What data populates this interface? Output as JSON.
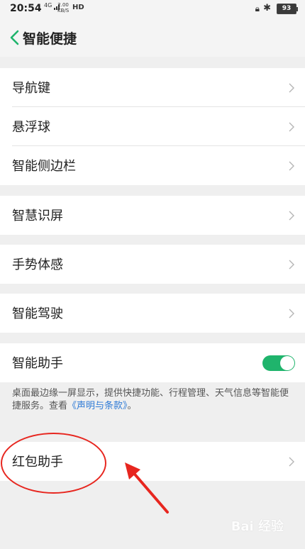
{
  "status_bar": {
    "time": "20:54",
    "network": "4G",
    "speed_value": "2.00",
    "speed_unit": "KB/S",
    "hd": "HD",
    "battery": "93",
    "icons": [
      "signal-icon",
      "hd-icon",
      "lock-rotation-icon",
      "bluetooth-icon",
      "battery-icon"
    ]
  },
  "header": {
    "title": "智能便捷"
  },
  "groups": {
    "g1": [
      "导航键",
      "悬浮球",
      "智能侧边栏"
    ],
    "g2": [
      "智慧识屏"
    ],
    "g3": [
      "手势体感"
    ],
    "g4": [
      "智能驾驶"
    ],
    "g5": [
      "智能助手"
    ],
    "g6": [
      "红包助手"
    ]
  },
  "assistant": {
    "toggle_on": true,
    "desc_text": "桌面最边缘一屏显示，提供快捷功能、行程管理、天气信息等智能便捷服务。查看",
    "desc_link": "《声明与条款》",
    "desc_end": "。"
  },
  "watermark": "Bai 经验",
  "colors": {
    "background": "#efefef",
    "back_arrow": "#1fb46c",
    "toggle_on": "#1fb46c",
    "link": "#2f7bd6",
    "annotation": "#e7261f"
  }
}
